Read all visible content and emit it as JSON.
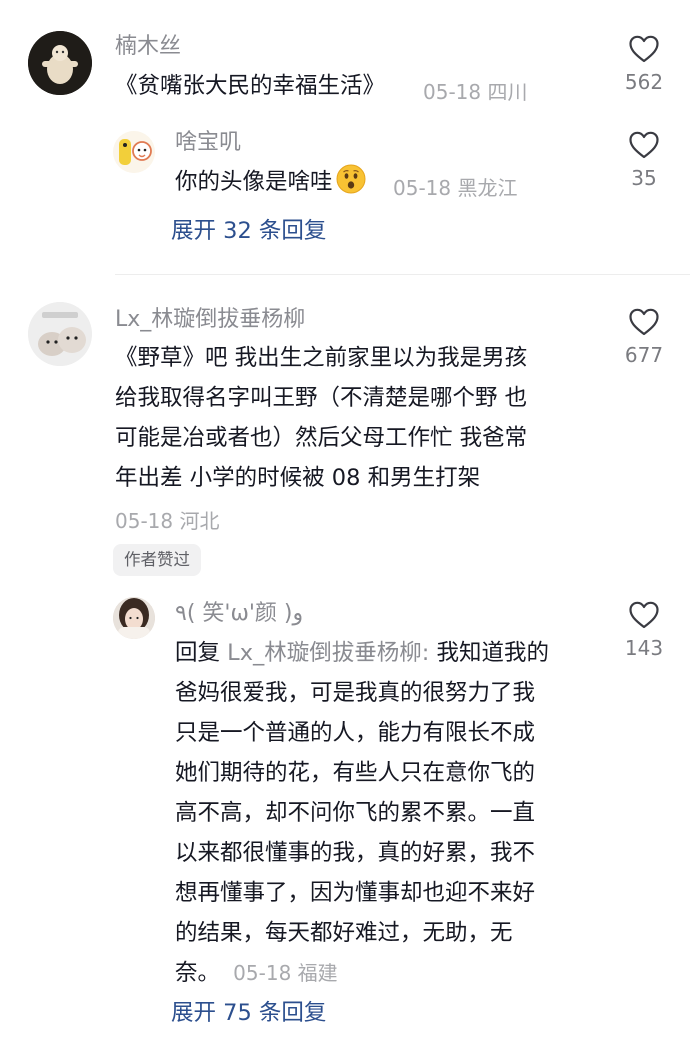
{
  "comments": [
    {
      "username": "楠木丝",
      "text": "《贫嘴张大民的幸福生活》",
      "date": "05-18",
      "location": "四川",
      "likes": "562",
      "avatar_icon": "figure-avatar-icon"
    },
    {
      "username": "Lx_林璇倒拔垂杨柳",
      "text_lines": [
        "《野草》吧 我出生之前家里以为我是男孩",
        "给我取得名字叫王野（不清楚是哪个野 也",
        "可能是冶或者也）然后父母工作忙 我爸常",
        "年出差 小学的时候被 08 和男生打架"
      ],
      "date": "05-18",
      "location": "河北",
      "likes": "677",
      "author_badge": "作者赞过",
      "avatar_icon": "hamster-avatar-icon"
    }
  ],
  "replies": [
    {
      "username": "啥宝叽",
      "text": "你的头像是啥哇",
      "emoji": "surprised-face-icon",
      "date": "05-18",
      "location": "黑龙江",
      "likes": "35"
    },
    {
      "username": "٩( 笑'ω'颜 )و",
      "reply_prefix": "回复",
      "reply_to": "Lx_林璇倒拔垂杨柳:",
      "text_first": "我知道我的",
      "text_lines": [
        "爸妈很爱我，可是我真的很努力了我",
        "只是一个普通的人，能力有限长不成",
        "她们期待的花，有些人只在意你飞的",
        "高不高，却不问你飞的累不累。一直",
        "以来都很懂事的我，真的好累，我不",
        "想再懂事了，因为懂事却也迎不来好",
        "的结果，每天都好难过，无助，无"
      ],
      "text_last": "奈。",
      "date": "05-18",
      "location": "福建",
      "likes": "143"
    }
  ],
  "expand_replies": [
    "展开 32 条回复",
    "展开 75 条回复"
  ],
  "colors": {
    "username": "#8a8b91",
    "body_text": "#161823",
    "meta": "#a8a9ad",
    "expand_link": "#2c4f8e"
  }
}
